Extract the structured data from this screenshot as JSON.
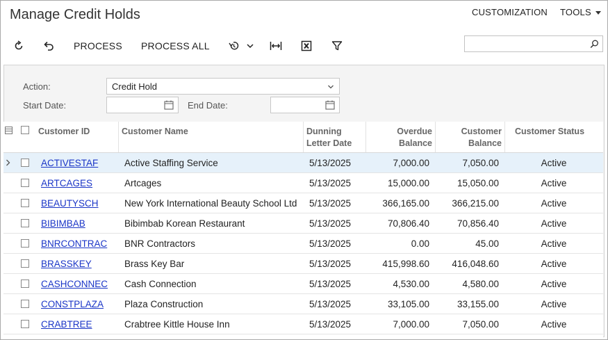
{
  "screen": {
    "title": "Manage Credit Holds",
    "customization_label": "CUSTOMIZATION",
    "tools_label": "TOOLS"
  },
  "toolbar": {
    "process_label": "PROCESS",
    "process_all_label": "PROCESS ALL",
    "search_placeholder": ""
  },
  "filters": {
    "action_label": "Action:",
    "action_value": "Credit Hold",
    "start_date_label": "Start Date:",
    "start_date_value": "",
    "end_date_label": "End Date:",
    "end_date_value": ""
  },
  "grid": {
    "columns": {
      "customer_id": "Customer ID",
      "customer_name": "Customer Name",
      "dunning_1": "Dunning",
      "dunning_2": "Letter Date",
      "overdue_1": "Overdue",
      "overdue_2": "Balance",
      "custbal_1": "Customer",
      "custbal_2": "Balance",
      "status": "Customer Status"
    },
    "rows": [
      {
        "id": "ACTIVESTAF",
        "name": "Active Staffing Service",
        "date": "5/13/2025",
        "overdue": "7,000.00",
        "balance": "7,050.00",
        "status": "Active"
      },
      {
        "id": "ARTCAGES",
        "name": "Artcages",
        "date": "5/13/2025",
        "overdue": "15,000.00",
        "balance": "15,050.00",
        "status": "Active"
      },
      {
        "id": "BEAUTYSCH",
        "name": "New York International Beauty School Ltd",
        "date": "5/13/2025",
        "overdue": "366,165.00",
        "balance": "366,215.00",
        "status": "Active"
      },
      {
        "id": "BIBIMBAB",
        "name": "Bibimbab Korean Restaurant",
        "date": "5/13/2025",
        "overdue": "70,806.40",
        "balance": "70,856.40",
        "status": "Active"
      },
      {
        "id": "BNRCONTRAC",
        "name": "BNR Contractors",
        "date": "5/13/2025",
        "overdue": "0.00",
        "balance": "45.00",
        "status": "Active"
      },
      {
        "id": "BRASSKEY",
        "name": "Brass Key Bar",
        "date": "5/13/2025",
        "overdue": "415,998.60",
        "balance": "416,048.60",
        "status": "Active"
      },
      {
        "id": "CASHCONNEC",
        "name": "Cash Connection",
        "date": "5/13/2025",
        "overdue": "4,530.00",
        "balance": "4,580.00",
        "status": "Active"
      },
      {
        "id": "CONSTPLAZA",
        "name": "Plaza Construction",
        "date": "5/13/2025",
        "overdue": "33,105.00",
        "balance": "33,155.00",
        "status": "Active"
      },
      {
        "id": "CRABTREE",
        "name": "Crabtree Kittle House Inn",
        "date": "5/13/2025",
        "overdue": "7,000.00",
        "balance": "7,050.00",
        "status": "Active"
      }
    ]
  }
}
